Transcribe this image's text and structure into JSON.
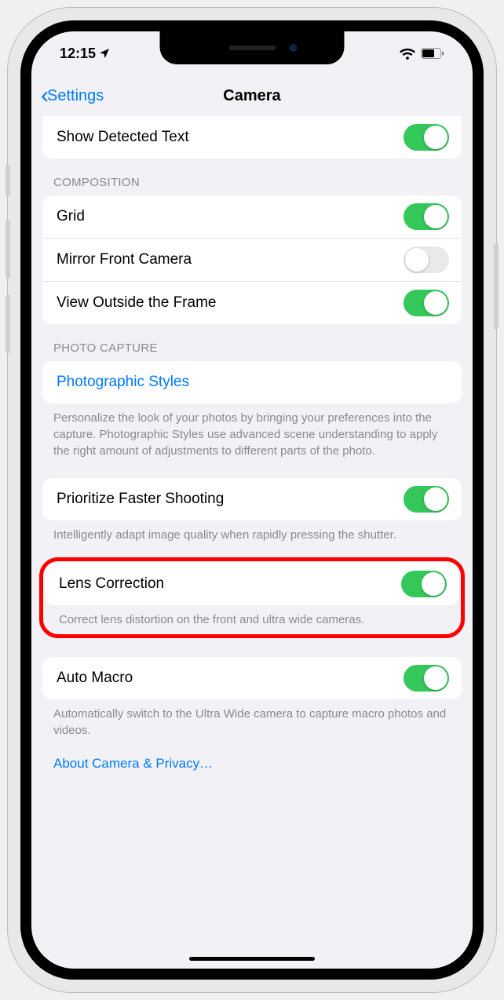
{
  "status": {
    "time": "12:15"
  },
  "nav": {
    "back": "Settings",
    "title": "Camera"
  },
  "top": {
    "show_detected_text": "Show Detected Text"
  },
  "composition": {
    "header": "COMPOSITION",
    "grid": "Grid",
    "mirror": "Mirror Front Camera",
    "view_outside": "View Outside the Frame"
  },
  "capture": {
    "header": "PHOTO CAPTURE",
    "styles": "Photographic Styles",
    "styles_footer": "Personalize the look of your photos by bringing your preferences into the capture. Photographic Styles use advanced scene understanding to apply the right amount of adjustments to different parts of the photo.",
    "priority": "Prioritize Faster Shooting",
    "priority_footer": "Intelligently adapt image quality when rapidly pressing the shutter.",
    "lens": "Lens Correction",
    "lens_footer": "Correct lens distortion on the front and ultra wide cameras.",
    "macro": "Auto Macro",
    "macro_footer": "Automatically switch to the Ultra Wide camera to capture macro photos and videos."
  },
  "about_link": "About Camera & Privacy…"
}
